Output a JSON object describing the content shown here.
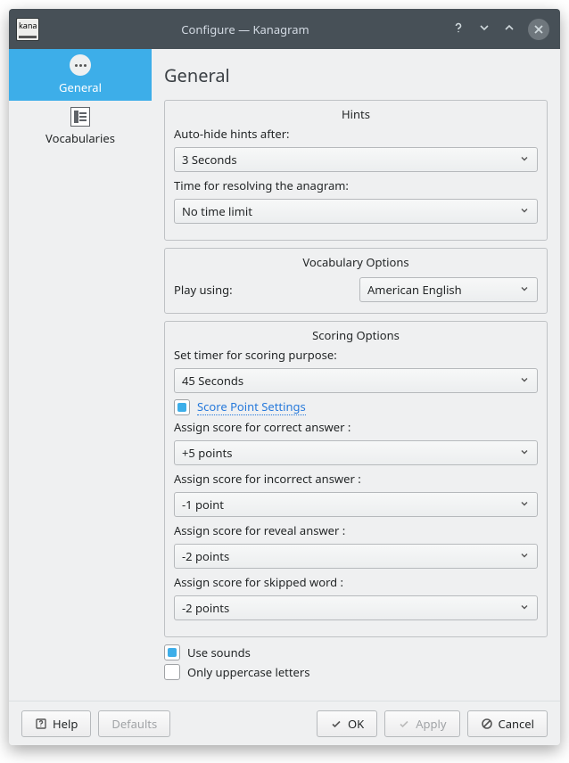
{
  "window": {
    "title": "Configure — Kanagram",
    "app_icon_text": "kana"
  },
  "sidebar": {
    "items": [
      {
        "label": "General"
      },
      {
        "label": "Vocabularies"
      }
    ]
  },
  "page": {
    "title": "General"
  },
  "hints_group": {
    "legend": "Hints",
    "autohide_label": "Auto-hide hints after:",
    "autohide_value": "3 Seconds",
    "resolve_label": "Time for resolving the anagram:",
    "resolve_value": "No time limit"
  },
  "vocab_group": {
    "legend": "Vocabulary Options",
    "play_label": "Play using:",
    "play_value": "American English"
  },
  "scoring_group": {
    "legend": "Scoring Options",
    "timer_label": "Set timer for scoring purpose:",
    "timer_value": "45 Seconds",
    "score_point_settings": "Score Point Settings",
    "correct_label": "Assign score for correct answer :",
    "correct_value": "+5 points",
    "incorrect_label": "Assign score for incorrect answer :",
    "incorrect_value": "-1 point",
    "reveal_label": "Assign score for reveal answer :",
    "reveal_value": "-2 points",
    "skipped_label": "Assign score for skipped word :",
    "skipped_value": "-2 points"
  },
  "options": {
    "use_sounds": "Use sounds",
    "uppercase": "Only uppercase letters"
  },
  "footer": {
    "help": "Help",
    "defaults": "Defaults",
    "ok": "OK",
    "apply": "Apply",
    "cancel": "Cancel"
  }
}
